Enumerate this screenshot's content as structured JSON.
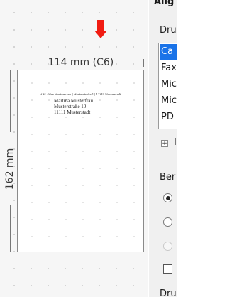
{
  "preview": {
    "width_label": "114 mm (C6)",
    "height_label": "162 mm",
    "sender_line": "ABS.: Max Mustermann | Musterstraße 1 | 12345 Musterstadt",
    "address": {
      "line1": "Martina Musterfrau",
      "line2": "Musterstraße 10",
      "line3": "11111 Musterstadt"
    },
    "marker_color": "#f11c12"
  },
  "panel": {
    "title": "Allg",
    "printer_label": "Dru",
    "printer_list": [
      "Ca",
      "Fax",
      "Mic",
      "Mic",
      "PD"
    ],
    "expander_text": "I",
    "section_label": "Ber",
    "radio_states": [
      "checked",
      "unchecked",
      "disabled"
    ],
    "bottom_label": "Dru"
  }
}
